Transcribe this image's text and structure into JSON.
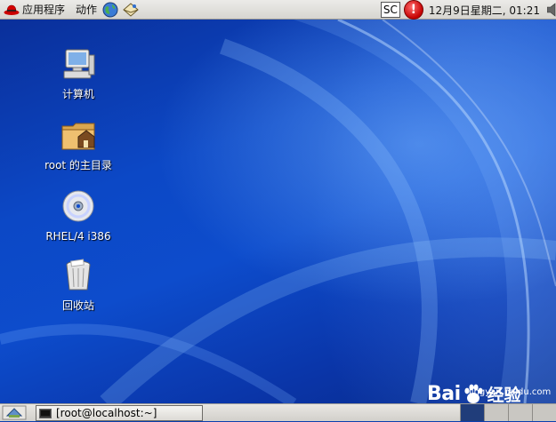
{
  "top_panel": {
    "applications_label": "应用程序",
    "actions_label": "动作",
    "input_indicator": "SC",
    "clock": "12月9日星期二, 01:21"
  },
  "desktop": {
    "icons": [
      {
        "label": "计算机",
        "icon": "computer-icon"
      },
      {
        "label": "root 的主目录",
        "icon": "home-folder-icon"
      },
      {
        "label": "RHEL/4 i386",
        "icon": "cdrom-icon"
      },
      {
        "label": "回收站",
        "icon": "trash-icon"
      }
    ]
  },
  "bottom_panel": {
    "task_label": "[root@localhost:~]",
    "workspaces": 4,
    "active_workspace": 1
  },
  "watermark": {
    "brand_left": "Bai",
    "brand_right": "经验",
    "url": "jingyan.baidu.com"
  }
}
